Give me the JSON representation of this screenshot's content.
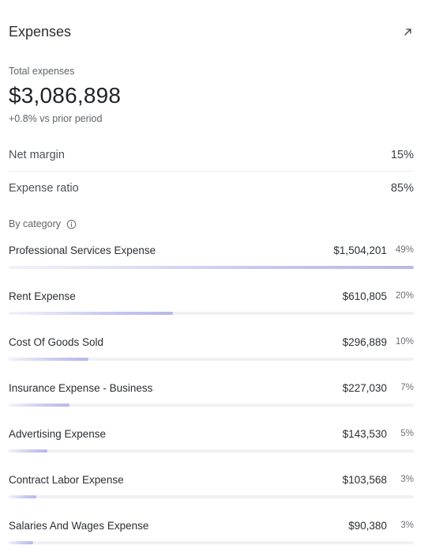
{
  "header": {
    "title": "Expenses",
    "open_icon": "arrow-up-right-icon"
  },
  "summary": {
    "total_label": "Total expenses",
    "total_value": "$3,086,898",
    "change_text": "+0.8% vs prior period"
  },
  "metrics": [
    {
      "label": "Net margin",
      "value": "15%"
    },
    {
      "label": "Expense ratio",
      "value": "85%"
    }
  ],
  "categories_section": {
    "label": "By category",
    "info_icon": "info-icon",
    "items": [
      {
        "name": "Professional Services Expense",
        "amount": "$1,504,201",
        "percent": "49%",
        "share": 1.0
      },
      {
        "name": "Rent Expense",
        "amount": "$610,805",
        "percent": "20%",
        "share": 0.406
      },
      {
        "name": "Cost Of Goods Sold",
        "amount": "$296,889",
        "percent": "10%",
        "share": 0.197
      },
      {
        "name": "Insurance Expense - Business",
        "amount": "$227,030",
        "percent": "7%",
        "share": 0.151
      },
      {
        "name": "Advertising Expense",
        "amount": "$143,530",
        "percent": "5%",
        "share": 0.095
      },
      {
        "name": "Contract Labor Expense",
        "amount": "$103,568",
        "percent": "3%",
        "share": 0.069
      },
      {
        "name": "Salaries And Wages Expense",
        "amount": "$90,380",
        "percent": "3%",
        "share": 0.06
      }
    ]
  },
  "colors": {
    "bar_fill": "#b8b8ec",
    "bar_track": "#f1f1f4"
  }
}
